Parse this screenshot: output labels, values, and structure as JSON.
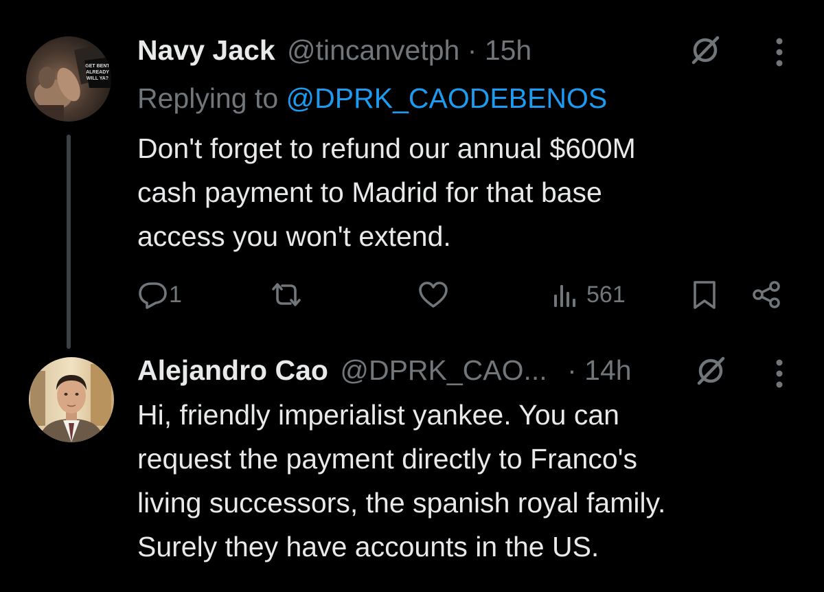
{
  "tweets": [
    {
      "name": "Navy Jack",
      "handle": "@tincanvetph",
      "separator": "·",
      "time": "15h",
      "replying_label": "Replying to",
      "replying_to": "@DPRK_CAODEBENOS",
      "text_lines": [
        "Don't forget to refund our annual $600M",
        "cash payment to Madrid for that base",
        "access you won't extend."
      ],
      "actions": {
        "replies": "1",
        "reposts": "",
        "likes": "",
        "views": "561"
      },
      "avatar_badge_lines": [
        "GET BENT",
        "ALREADY",
        "WILL YA?"
      ],
      "icons": [
        "grok-icon",
        "more-icon",
        "reply-icon",
        "repost-icon",
        "like-icon",
        "views-icon",
        "bookmark-icon",
        "share-icon"
      ]
    },
    {
      "name": "Alejandro Cao",
      "handle": "@DPRK_CAO...",
      "separator": "·",
      "time": "14h",
      "text_lines": [
        "Hi, friendly imperialist yankee. You can",
        "request the payment directly to Franco's",
        "living successors, the spanish royal family.",
        "Surely they have accounts in the US."
      ],
      "icons": [
        "grok-icon",
        "more-icon"
      ]
    }
  ],
  "colors": {
    "background": "#000000",
    "text": "#e7e9ea",
    "muted": "#71767b",
    "link": "#1d9bf0"
  }
}
